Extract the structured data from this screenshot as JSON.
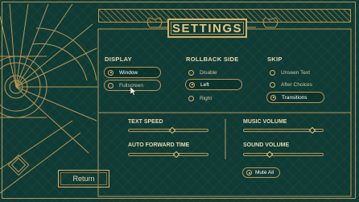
{
  "title": "SETTINGS",
  "display": {
    "title": "DISPLAY",
    "options": [
      "Window",
      "Fullscreen"
    ],
    "selected": "Window"
  },
  "rollback": {
    "title": "ROLLBACK SIDE",
    "options": [
      "Disable",
      "Left",
      "Right"
    ],
    "selected": "Left"
  },
  "skip": {
    "title": "SKIP",
    "options": [
      "Unseen Text",
      "After Choices",
      "Transitions"
    ],
    "selected": "Transitions"
  },
  "text_speed": {
    "label": "TEXT SPEED",
    "value": 0.55
  },
  "auto_forward": {
    "label": "AUTO FORWARD TIME",
    "value": 0.6
  },
  "music_volume": {
    "label": "MUSIC VOLUME",
    "value": 0.86
  },
  "sound_volume": {
    "label": "SOUND VOLUME",
    "value": 0.33
  },
  "mute_all": "Mute All",
  "return_label": "Return",
  "colors": {
    "background": "#0f3b34",
    "gold": "#d4b06c",
    "text": "#e8d7ae"
  }
}
